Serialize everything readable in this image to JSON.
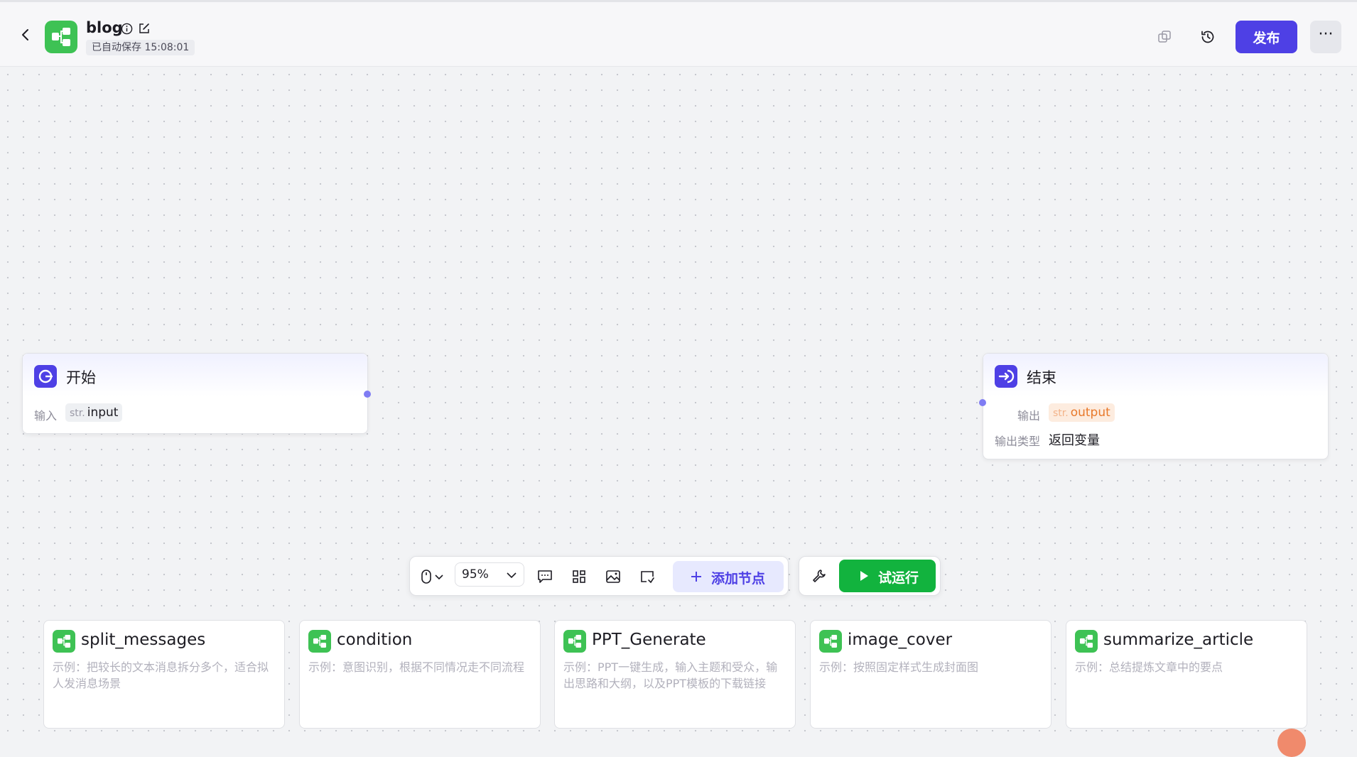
{
  "header": {
    "app_name": "blog",
    "autosave": "已自动保存 15:08:01",
    "publish_label": "发布",
    "more_label": "···"
  },
  "nodes": {
    "start": {
      "title": "开始",
      "input_label": "输入",
      "input_type": "str.",
      "input_name": "input"
    },
    "end": {
      "title": "结束",
      "output_label": "输出",
      "output_type": "str.",
      "output_name": "output",
      "output_type_label": "输出类型",
      "output_type_value": "返回变量"
    }
  },
  "toolbar": {
    "zoom": "95%",
    "add_node_label": "添加节点",
    "test_run_label": "试运行"
  },
  "templates": [
    {
      "title": "split_messages",
      "desc": "示例：把较长的文本消息拆分多个，适合拟人发消息场景"
    },
    {
      "title": "condition",
      "desc": "示例：意图识别，根据不同情况走不同流程"
    },
    {
      "title": "PPT_Generate",
      "desc": "示例：PPT一键生成，输入主题和受众，输出思路和大纲，以及PPT模板的下载链接"
    },
    {
      "title": "image_cover",
      "desc": "示例：按照固定样式生成封面图"
    },
    {
      "title": "summarize_article",
      "desc": "示例：总结提炼文章中的要点"
    }
  ],
  "colors": {
    "accent": "#4e40e5",
    "app_green": "#3ec254",
    "run_green": "#12b33e",
    "output_tag": "#e8792b"
  }
}
